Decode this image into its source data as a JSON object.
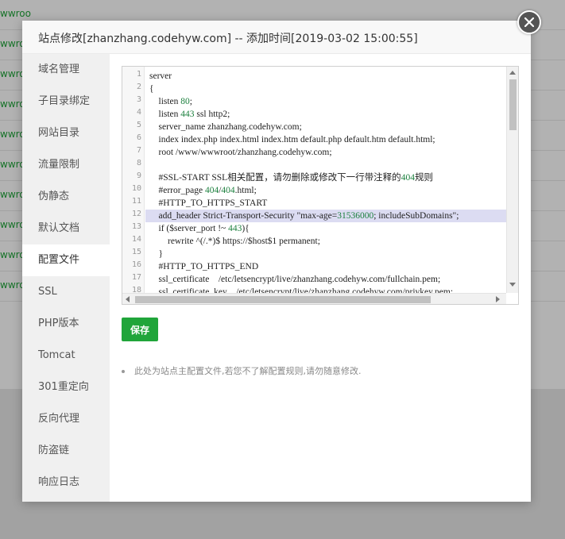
{
  "background": {
    "row_link_text": "wwroo",
    "rows": 10
  },
  "modal": {
    "title": "站点修改[zhanzhang.codehyw.com] -- 添加时间[2019-03-02 15:00:55]",
    "close_icon": "close-icon"
  },
  "sidebar": {
    "items": [
      {
        "label": "域名管理"
      },
      {
        "label": "子目录绑定"
      },
      {
        "label": "网站目录"
      },
      {
        "label": "流量限制"
      },
      {
        "label": "伪静态"
      },
      {
        "label": "默认文档"
      },
      {
        "label": "配置文件",
        "active": true
      },
      {
        "label": "SSL"
      },
      {
        "label": "PHP版本"
      },
      {
        "label": "Tomcat"
      },
      {
        "label": "301重定向"
      },
      {
        "label": "反向代理"
      },
      {
        "label": "防盗链"
      },
      {
        "label": "响应日志"
      }
    ]
  },
  "editor": {
    "line_numbers": [
      "1",
      "2",
      "3",
      "4",
      "5",
      "6",
      "7",
      "8",
      "9",
      "10",
      "11",
      "12",
      "13",
      "14",
      "15",
      "16",
      "17",
      "18"
    ],
    "highlighted_line": 12,
    "lines": [
      "server",
      "{",
      "    listen 80;",
      "    listen 443 ssl http2;",
      "    server_name zhanzhang.codehyw.com;",
      "    index index.php index.html index.htm default.php default.htm default.html;",
      "    root /www/wwwroot/zhanzhang.codehyw.com;",
      "",
      "    #SSL-START SSL相关配置，请勿删除或修改下一行带注释的404规则",
      "    #error_page 404/404.html;",
      "    #HTTP_TO_HTTPS_START",
      "    add_header Strict-Transport-Security \"max-age=31536000; includeSubDomains\";",
      "    if ($server_port !~ 443){",
      "        rewrite ^(/.*)$ https://$host$1 permanent;",
      "    }",
      "    #HTTP_TO_HTTPS_END",
      "    ssl_certificate    /etc/letsencrypt/live/zhanzhang.codehyw.com/fullchain.pem;",
      "    ssl_certificate_key    /etc/letsencrypt/live/zhanzhang.codehyw.com/privkey.pem;"
    ]
  },
  "save_label": "保存",
  "note": "此处为站点主配置文件,若您不了解配置规则,请勿随意修改.",
  "colors": {
    "accent": "#20a53a",
    "sidebar_bg": "#f0f0f0",
    "highlight_line": "#dcdcf2"
  }
}
